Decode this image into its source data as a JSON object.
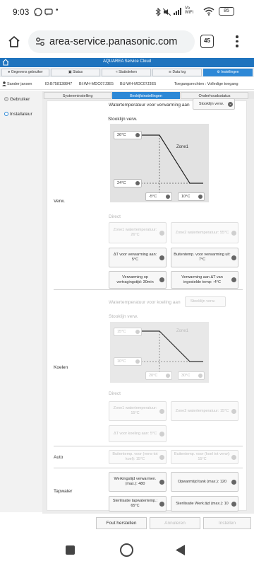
{
  "status_bar": {
    "time": "9:03",
    "battery": "85",
    "network": "Vo WiFi"
  },
  "browser": {
    "url": "area-service.panasonic.com",
    "tab_count": "45"
  },
  "app": {
    "title": "AQUAREA Service Cloud"
  },
  "nav": [
    {
      "label": "Gegevens gebruiker"
    },
    {
      "label": "Status"
    },
    {
      "label": "Statistieken"
    },
    {
      "label": "Data log"
    },
    {
      "label": "Instellingen"
    }
  ],
  "info": {
    "user": "Sander jansen",
    "id": "ID:B758138847",
    "bi": "BI:WH-MDC07J3E5",
    "bu": "BU:WH-MDC07J3E5",
    "access": "Toegangsrechten : Volledige toegang"
  },
  "sidebar": {
    "items": [
      {
        "label": "Gebruiker"
      },
      {
        "label": "Installateur"
      }
    ]
  },
  "tabs": [
    {
      "label": "Systeeminstelling"
    },
    {
      "label": "Bedrijfsinstellingen"
    },
    {
      "label": "Onderhoudsstatus"
    }
  ],
  "verw": {
    "section_label": "Verw.",
    "water_temp_label": "Watertemperatuur voor verwarming aan",
    "water_temp_value": "Stooklijn verw.",
    "curve_title": "Stooklijn verw.",
    "zone_label": "Zone1",
    "high_temp": "26°C",
    "low_temp": "24°C",
    "outdoor_low": "-5°C",
    "outdoor_high": "10°C",
    "direct_label": "Direct",
    "zone1_water": "Zone1 watertemperatuur: 26°C",
    "zone2_water": "Zone2 watertemperatuur: 55°C",
    "delta_t": "ΔT voor verwarming aan: 5°C",
    "outdoor_off": "Buitentemp. voor verwarming uit: 7°C",
    "delay": "Verwarming op vertragingstijd: 30min",
    "delta_t_set": "Verwarming aan ΔT van ingestelde temp: -4°C"
  },
  "koelen": {
    "section_label": "Koelen",
    "water_temp_label": "Watertemperatuur voor koeling aan",
    "water_temp_value": "Stooklijn verw.",
    "curve_title": "Stooklijn verw.",
    "zone_label": "Zone1",
    "high_temp": "15°C",
    "low_temp": "10°C",
    "outdoor_low": "20°C",
    "outdoor_high": "30°C",
    "direct_label": "Direct",
    "zone1_water": "Zone1 watertemperatuur: 15°C",
    "zone2_water": "Zone2 watertemperatuur: 15°C",
    "delta_t": "ΔT voor koeling aan: 5°C"
  },
  "auto": {
    "section_label": "Auto",
    "outdoor_heat": "Buitentemp. voor (verw tot koel): 15°C",
    "outdoor_cool": "Buitentemp. voor (koel tot verw): 15°C"
  },
  "tapwater": {
    "section_label": "Tapwater",
    "work_time": "Werkingstijd verwarmen. (max.): 480",
    "warmup_time": "Opwarmtijd tank (max.): 120",
    "sterilize_temp": "Sterilisatie tapwatertemp.: 65°C",
    "sterilize_time": "Sterilisatie Werk.tijd (max.): 10"
  },
  "footer": {
    "error_reset": "Fout herstellen",
    "cancel": "Annuleren",
    "set": "Instellen"
  },
  "colors": {
    "app_blue": "#1e73be",
    "active_tab": "#2d88d6"
  }
}
